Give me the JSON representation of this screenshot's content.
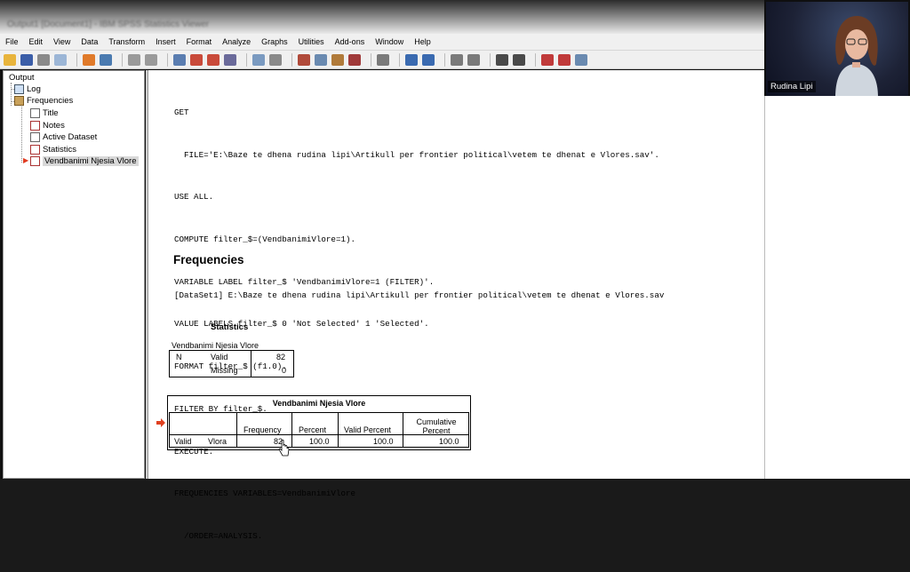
{
  "window": {
    "title": "Output1 [Document1] - IBM SPSS Statistics Viewer"
  },
  "menu": [
    "File",
    "Edit",
    "View",
    "Data",
    "Transform",
    "Insert",
    "Format",
    "Analyze",
    "Graphs",
    "Utilities",
    "Add-ons",
    "Window",
    "Help"
  ],
  "nav": {
    "root": "Output",
    "log": "Log",
    "frequencies": "Frequencies",
    "children": [
      "Title",
      "Notes",
      "Active Dataset",
      "Statistics",
      "Vendbanimi Njesia Vlore"
    ]
  },
  "syntax": [
    "GET",
    "  FILE='E:\\Baze te dhena rudina lipi\\Artikull per frontier political\\vetem te dhenat e Vlores.sav'.",
    "USE ALL.",
    "COMPUTE filter_$=(VendbanimiVlore=1).",
    "VARIABLE LABEL filter_$ 'VendbanimiVlore=1 (FILTER)'.",
    "VALUE LABELS filter_$ 0 'Not Selected' 1 'Selected'.",
    "FORMAT filter_$ (f1.0).",
    "FILTER BY filter_$.",
    "EXECUTE.",
    "FREQUENCIES VARIABLES=VendbanimiVlore",
    "  /ORDER=ANALYSIS."
  ],
  "heading": "Frequencies",
  "dataset_line": "[DataSet1] E:\\Baze te dhena rudina lipi\\Artikull per frontier political\\vetem te dhenat e Vlores.sav",
  "statistics": {
    "title": "Statistics",
    "caption": "Vendbanimi Njesia Vlore",
    "n_label": "N",
    "valid_label": "Valid",
    "valid_value": "82",
    "missing_label": "Missing",
    "missing_value": "0"
  },
  "freq_table": {
    "title": "Vendbanimi Njesia Vlore",
    "headers": [
      "Frequency",
      "Percent",
      "Valid Percent",
      "Cumulative Percent"
    ],
    "row": {
      "group": "Valid",
      "label": "Vlora",
      "frequency": "82",
      "percent": "100.0",
      "valid_percent": "100.0",
      "cumulative_percent": "100.0"
    }
  },
  "webcam": {
    "name": "Rudina Lipi"
  }
}
